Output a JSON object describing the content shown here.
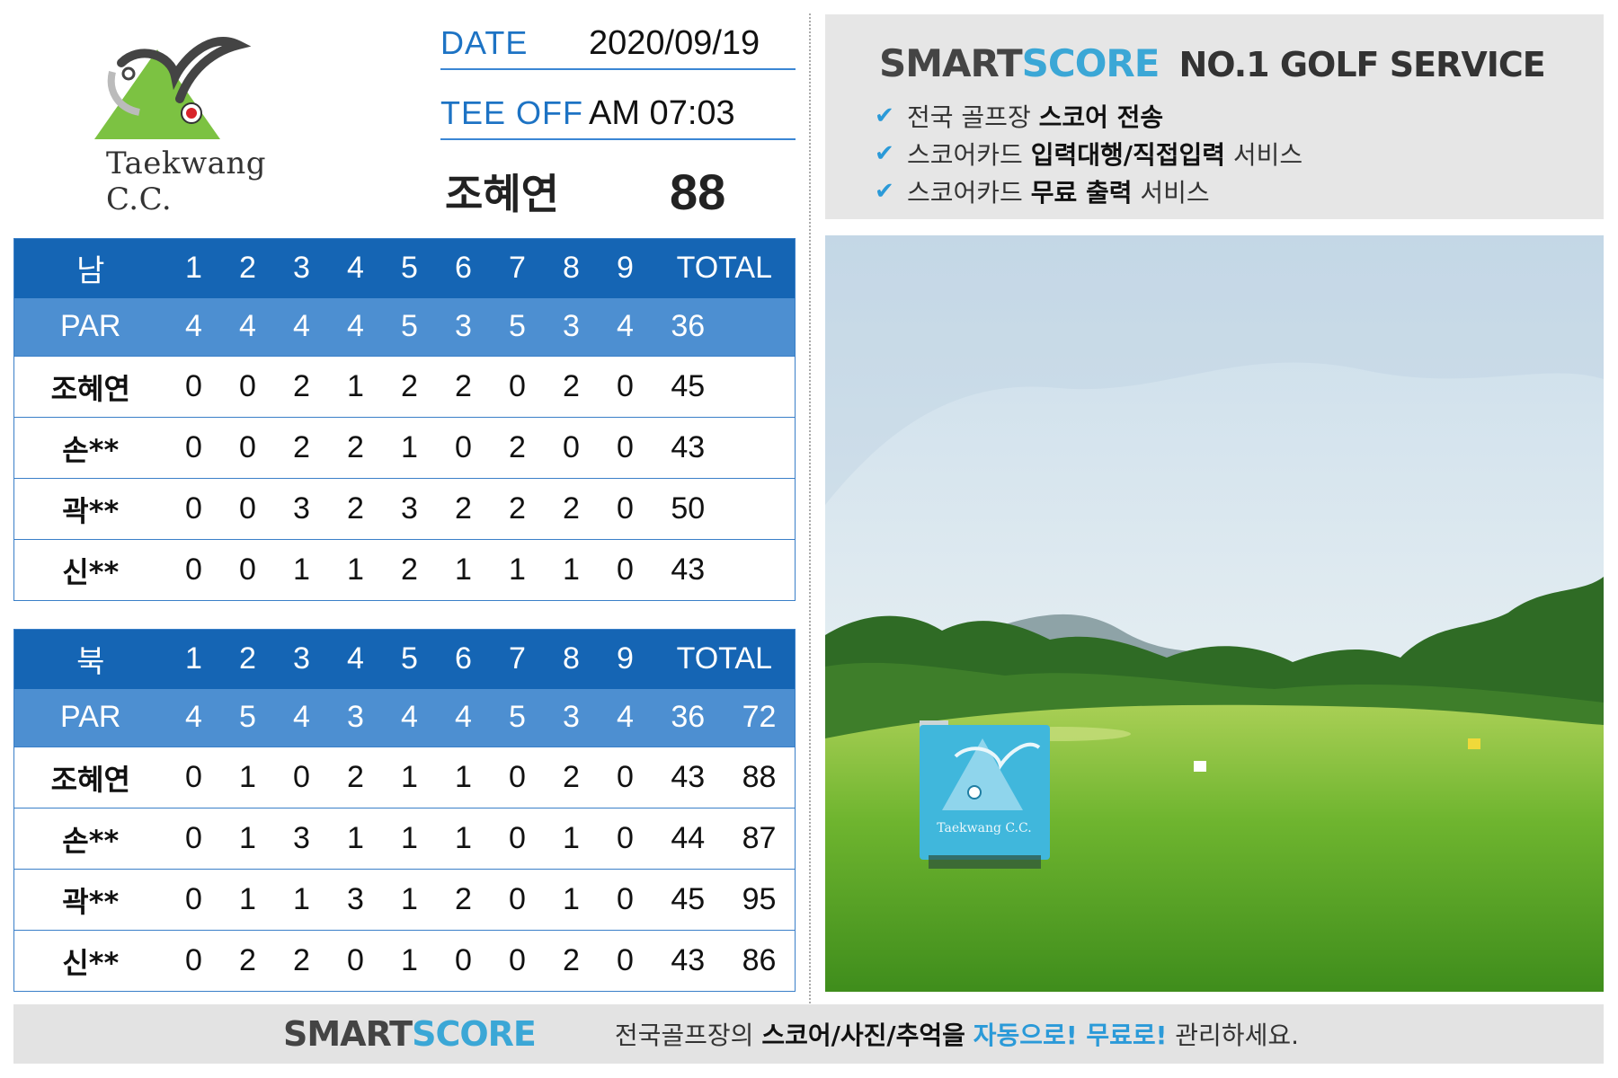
{
  "club": {
    "name": "Taekwang C.C."
  },
  "round": {
    "date_label": "DATE",
    "date_value": "2020/09/19",
    "tee_label": "TEE OFF",
    "tee_value": "AM 07:03",
    "player": "조혜연",
    "total": "88"
  },
  "courses": [
    {
      "name": "남",
      "holes": [
        "1",
        "2",
        "3",
        "4",
        "5",
        "6",
        "7",
        "8",
        "9"
      ],
      "total_label": "TOTAL",
      "par_label": "PAR",
      "par": [
        "4",
        "4",
        "4",
        "4",
        "5",
        "3",
        "5",
        "3",
        "4"
      ],
      "par_total": "36",
      "par_grand": "",
      "players": [
        {
          "name": "조혜연",
          "scores": [
            "0",
            "0",
            "2",
            "1",
            "2",
            "2",
            "0",
            "2",
            "0"
          ],
          "total": "45",
          "grand": ""
        },
        {
          "name": "손**",
          "scores": [
            "0",
            "0",
            "2",
            "2",
            "1",
            "0",
            "2",
            "0",
            "0"
          ],
          "total": "43",
          "grand": ""
        },
        {
          "name": "곽**",
          "scores": [
            "0",
            "0",
            "3",
            "2",
            "3",
            "2",
            "2",
            "2",
            "0"
          ],
          "total": "50",
          "grand": ""
        },
        {
          "name": "신**",
          "scores": [
            "0",
            "0",
            "1",
            "1",
            "2",
            "1",
            "1",
            "1",
            "0"
          ],
          "total": "43",
          "grand": ""
        }
      ]
    },
    {
      "name": "북",
      "holes": [
        "1",
        "2",
        "3",
        "4",
        "5",
        "6",
        "7",
        "8",
        "9"
      ],
      "total_label": "TOTAL",
      "par_label": "PAR",
      "par": [
        "4",
        "5",
        "4",
        "3",
        "4",
        "4",
        "5",
        "3",
        "4"
      ],
      "par_total": "36",
      "par_grand": "72",
      "players": [
        {
          "name": "조혜연",
          "scores": [
            "0",
            "1",
            "0",
            "2",
            "1",
            "1",
            "0",
            "2",
            "0"
          ],
          "total": "43",
          "grand": "88"
        },
        {
          "name": "손**",
          "scores": [
            "0",
            "1",
            "3",
            "1",
            "1",
            "1",
            "0",
            "1",
            "0"
          ],
          "total": "44",
          "grand": "87"
        },
        {
          "name": "곽**",
          "scores": [
            "0",
            "1",
            "1",
            "3",
            "1",
            "2",
            "0",
            "1",
            "0"
          ],
          "total": "45",
          "grand": "95"
        },
        {
          "name": "신**",
          "scores": [
            "0",
            "2",
            "2",
            "0",
            "1",
            "0",
            "0",
            "2",
            "0"
          ],
          "total": "43",
          "grand": "86"
        }
      ]
    }
  ],
  "promo": {
    "brand_smart": "SMART",
    "brand_score": "SCORE",
    "tagline": "NO.1 GOLF SERVICE",
    "items": [
      {
        "pre": "전국 골프장 ",
        "bold": "스코어 전송",
        "post": ""
      },
      {
        "pre": "스코어카드 ",
        "bold": "입력대행/직접입력",
        "post": " 서비스"
      },
      {
        "pre": "스코어카드 ",
        "bold": "무료 출력",
        "post": " 서비스"
      }
    ]
  },
  "banner": {
    "brand_smart": "SMART",
    "brand_score": "SCORE",
    "slogan_pre": "전국골프장의 ",
    "slogan_bold": "스코어/사진/추억을",
    "slogan_space": " ",
    "slogan_hl": "자동으로! 무료로!",
    "slogan_post": " 관리하세요."
  },
  "colors": {
    "header_blue": "#1565b4",
    "par_blue": "#4d8fd1",
    "accent": "#3ba7d6"
  }
}
